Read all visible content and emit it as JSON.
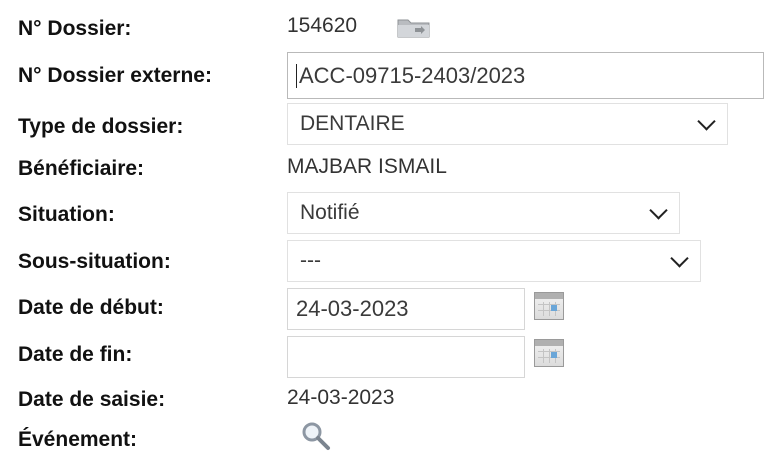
{
  "dossier": {
    "numero_label": "N° Dossier:",
    "numero_value": "154620",
    "externe_label": "N° Dossier externe:",
    "externe_value": "ACC-09715-2403/2023",
    "type_label": "Type de dossier:",
    "type_value": "DENTAIRE",
    "beneficiaire_label": "Bénéficiaire:",
    "beneficiaire_value": "MAJBAR ISMAIL",
    "situation_label": "Situation:",
    "situation_value": "Notifié",
    "sous_situation_label": "Sous-situation:",
    "sous_situation_value": "---",
    "date_debut_label": "Date de début:",
    "date_debut_value": "24-03-2023",
    "date_fin_label": "Date de fin:",
    "date_fin_value": "",
    "date_saisie_label": "Date de saisie:",
    "date_saisie_value": "24-03-2023",
    "evenement_label": "Événement:"
  },
  "icons": {
    "folder": "folder-icon",
    "calendar": "calendar-icon",
    "search": "magnifier-icon",
    "chevron": "chevron-down-icon"
  }
}
